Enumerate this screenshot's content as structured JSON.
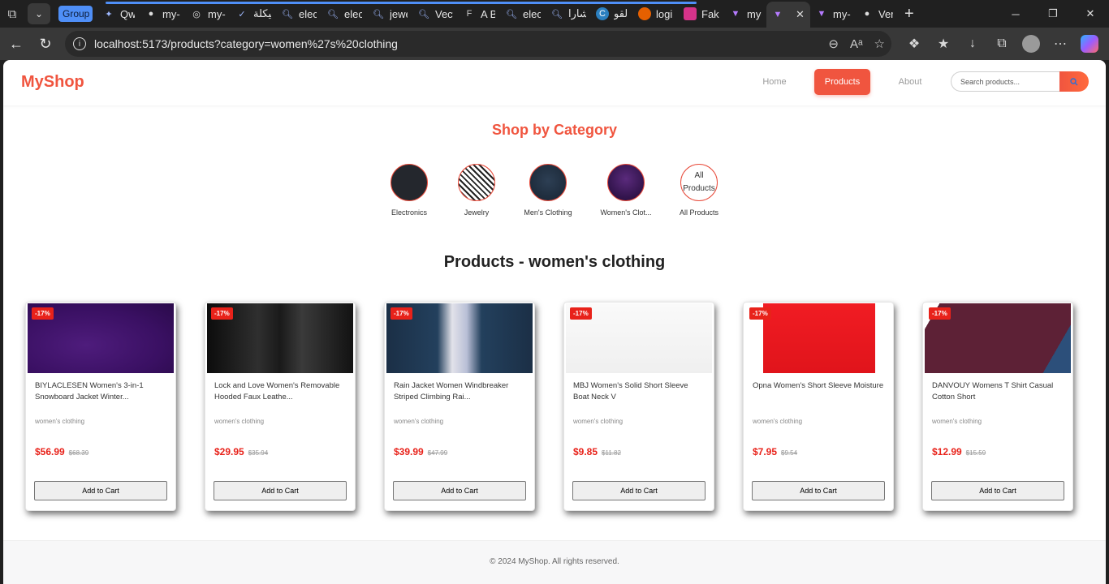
{
  "browser": {
    "tab_group_label": "Group",
    "tabs": [
      {
        "title": "Qwe",
        "icon": "qwen-icon"
      },
      {
        "title": "my-",
        "icon": "github-icon"
      },
      {
        "title": "my-",
        "icon": "globe-icon"
      },
      {
        "title": "هيكلة",
        "icon": "app-icon"
      },
      {
        "title": "elec",
        "icon": "search-icon"
      },
      {
        "title": "elec",
        "icon": "search-icon"
      },
      {
        "title": "jewe",
        "icon": "search-icon"
      },
      {
        "title": "Vect",
        "icon": "search-icon"
      },
      {
        "title": "A Br",
        "icon": "font-icon"
      },
      {
        "title": "elec",
        "icon": "search-icon"
      },
      {
        "title": "شارا",
        "icon": "search-icon"
      },
      {
        "title": "القو",
        "icon": "copilot-icon"
      },
      {
        "title": "logi",
        "icon": "firefox-icon"
      },
      {
        "title": "Fake",
        "icon": "app-icon"
      },
      {
        "title": "my-",
        "icon": "vite-icon"
      },
      {
        "title": "",
        "icon": "vite-icon",
        "active": true
      },
      {
        "title": "my-",
        "icon": "vite-icon"
      },
      {
        "title": "Verif",
        "icon": "github-icon"
      }
    ],
    "url": "localhost:5173/products?category=women%27s%20clothing"
  },
  "header": {
    "logo": "MyShop",
    "nav": {
      "home": "Home",
      "products": "Products",
      "about": "About"
    },
    "search_placeholder": "Search products..."
  },
  "categories": {
    "title": "Shop by Category",
    "items": [
      {
        "label": "Electronics"
      },
      {
        "label": "Jewelry"
      },
      {
        "label": "Men's Clothing"
      },
      {
        "label": "Women's Clot..."
      },
      {
        "label": "All Products",
        "image_alt": "All Products"
      }
    ]
  },
  "products": {
    "title": "Products - women's clothing",
    "items": [
      {
        "badge": "-17%",
        "name": "BIYLACLESEN Women's 3-in-1 Snowboard Jacket Winter...",
        "category": "women's clothing",
        "price": "$56.99",
        "old_price": "$68.39",
        "button": "Add to Cart"
      },
      {
        "badge": "-17%",
        "name": "Lock and Love Women's Removable Hooded Faux Leathe...",
        "category": "women's clothing",
        "price": "$29.95",
        "old_price": "$35.94",
        "button": "Add to Cart"
      },
      {
        "badge": "-17%",
        "name": "Rain Jacket Women Windbreaker Striped Climbing Rai...",
        "category": "women's clothing",
        "price": "$39.99",
        "old_price": "$47.99",
        "button": "Add to Cart"
      },
      {
        "badge": "-17%",
        "name": "MBJ Women's Solid Short Sleeve Boat Neck V",
        "category": "women's clothing",
        "price": "$9.85",
        "old_price": "$11.82",
        "button": "Add to Cart"
      },
      {
        "badge": "-17%",
        "name": "Opna Women's Short Sleeve Moisture",
        "category": "women's clothing",
        "price": "$7.95",
        "old_price": "$9.54",
        "button": "Add to Cart"
      },
      {
        "badge": "-17%",
        "name": "DANVOUY Womens T Shirt Casual Cotton Short",
        "category": "women's clothing",
        "price": "$12.99",
        "old_price": "$15.59",
        "button": "Add to Cart"
      }
    ]
  },
  "footer": {
    "text": "© 2024 MyShop. All rights reserved."
  },
  "colors": {
    "accent": "#f0553f",
    "price": "#e8221a",
    "badge": "#e8221a"
  }
}
